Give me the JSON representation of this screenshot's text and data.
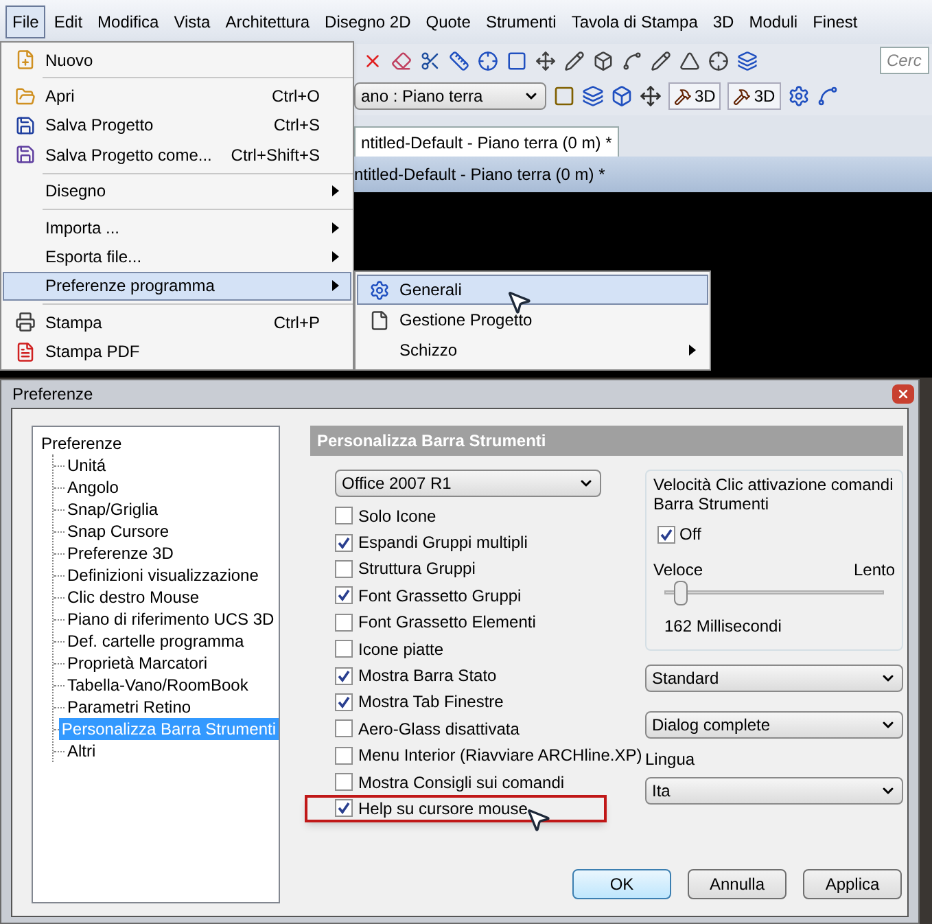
{
  "menubar": [
    {
      "label": "File",
      "selected": true
    },
    {
      "label": "Edit",
      "selected": false
    },
    {
      "label": "Modifica",
      "selected": false
    },
    {
      "label": "Vista",
      "selected": false
    },
    {
      "label": "Architettura",
      "selected": false
    },
    {
      "label": "Disegno 2D",
      "selected": false
    },
    {
      "label": "Quote",
      "selected": false
    },
    {
      "label": "Strumenti",
      "selected": false
    },
    {
      "label": "Tavola di Stampa",
      "selected": false
    },
    {
      "label": "3D",
      "selected": false
    },
    {
      "label": "Moduli",
      "selected": false
    },
    {
      "label": "Finest",
      "selected": false
    }
  ],
  "toolbar": {
    "search": {
      "placeholder": "Cerc"
    },
    "floor_combo": {
      "value": "ano : Piano terra"
    },
    "view_buttons": [
      "3D",
      "3D"
    ]
  },
  "document_tab": {
    "label": "ntitled-Default - Piano terra (0 m) *"
  },
  "document_title": "ntitled-Default - Piano terra (0 m) *",
  "file_menu": [
    {
      "kind": "item",
      "label": "Nuovo",
      "submenu": false,
      "selected": false
    },
    {
      "kind": "separator"
    },
    {
      "kind": "item",
      "label": "Apri",
      "shortcut": "Ctrl+O",
      "submenu": false,
      "selected": false
    },
    {
      "kind": "item",
      "label": "Salva Progetto",
      "shortcut": "Ctrl+S",
      "submenu": false,
      "selected": false
    },
    {
      "kind": "item",
      "label": "Salva Progetto come...",
      "shortcut": "Ctrl+Shift+S",
      "submenu": false,
      "selected": false
    },
    {
      "kind": "separator"
    },
    {
      "kind": "item",
      "label": "Disegno",
      "submenu": true,
      "selected": false
    },
    {
      "kind": "separator"
    },
    {
      "kind": "item",
      "label": "Importa ...",
      "submenu": true,
      "selected": false
    },
    {
      "kind": "item",
      "label": "Esporta file...",
      "submenu": true,
      "selected": false
    },
    {
      "kind": "item",
      "label": "Preferenze programma",
      "submenu": true,
      "selected": true
    },
    {
      "kind": "separator"
    },
    {
      "kind": "item",
      "label": "Stampa",
      "shortcut": "Ctrl+P",
      "submenu": false,
      "selected": false
    },
    {
      "kind": "item",
      "label": "Stampa PDF",
      "submenu": false,
      "selected": false
    }
  ],
  "preferences_submenu": [
    {
      "label": "Generali",
      "submenu": false,
      "selected": true
    },
    {
      "label": "Gestione Progetto",
      "submenu": false,
      "selected": false
    },
    {
      "label": "Schizzo",
      "submenu": true,
      "selected": false
    }
  ],
  "dialog": {
    "title": "Preferenze",
    "tree": {
      "label": "Preferenze",
      "children": [
        {
          "label": "Unitá",
          "selected": false
        },
        {
          "label": "Angolo",
          "selected": false
        },
        {
          "label": "Snap/Griglia",
          "selected": false
        },
        {
          "label": "Snap Cursore",
          "selected": false
        },
        {
          "label": "Preferenze 3D",
          "selected": false
        },
        {
          "label": "Definizioni visualizzazione",
          "selected": false
        },
        {
          "label": "Clic destro Mouse",
          "selected": false
        },
        {
          "label": "Piano di riferimento UCS 3D",
          "selected": false
        },
        {
          "label": "Def. cartelle programma",
          "selected": false
        },
        {
          "label": "Proprietà Marcatori",
          "selected": false
        },
        {
          "label": "Tabella-Vano/RoomBook",
          "selected": false
        },
        {
          "label": "Parametri Retino",
          "selected": false
        },
        {
          "label": "Personalizza Barra Strumenti",
          "selected": true
        },
        {
          "label": "Altri",
          "selected": false
        }
      ]
    },
    "section_title": "Personalizza Barra Strumenti",
    "style_dropdown": "Office 2007 R1",
    "options": [
      {
        "label": "Solo Icone",
        "checked": false,
        "highlighted": false
      },
      {
        "label": "Espandi Gruppi multipli",
        "checked": true,
        "highlighted": false
      },
      {
        "label": "Struttura Gruppi",
        "checked": false,
        "highlighted": false
      },
      {
        "label": "Font Grassetto Gruppi",
        "checked": true,
        "highlighted": false
      },
      {
        "label": "Font Grassetto Elementi",
        "checked": false,
        "highlighted": false
      },
      {
        "label": "Icone piatte",
        "checked": false,
        "highlighted": false
      },
      {
        "label": "Mostra Barra Stato",
        "checked": true,
        "highlighted": false
      },
      {
        "label": "Mostra Tab Finestre",
        "checked": true,
        "highlighted": false
      },
      {
        "label": "Aero-Glass disattivata",
        "checked": false,
        "highlighted": false
      },
      {
        "label": "Menu Interior (Riavviare ARCHline.XP)",
        "checked": false,
        "highlighted": false
      },
      {
        "label": "Mostra Consigli sui comandi",
        "checked": false,
        "highlighted": false
      },
      {
        "label": "Help su cursore mouse",
        "checked": true,
        "highlighted": true
      }
    ],
    "speed_group": {
      "title": "Velocità Clic attivazione comandi Barra Strumenti",
      "off": {
        "label": "Off",
        "checked": true
      },
      "min_label": "Veloce",
      "max_label": "Lento",
      "level": 0.07,
      "reading": "162 Millisecondi"
    },
    "mode_dropdown": "Standard",
    "dialog_dropdown": "Dialog complete",
    "language_label": "Lingua",
    "language_dropdown": "Ita",
    "buttons": [
      {
        "label": "OK",
        "default": true
      },
      {
        "label": "Annulla",
        "default": false
      },
      {
        "label": "Applica",
        "default": false
      }
    ]
  }
}
